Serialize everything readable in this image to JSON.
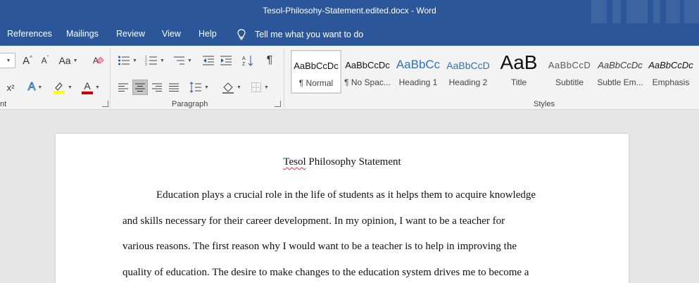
{
  "window": {
    "title": "Tesol-Philosohy-Statement.edited.docx  -  Word"
  },
  "menu": {
    "references": "References",
    "mailings": "Mailings",
    "review": "Review",
    "view": "View",
    "help": "Help",
    "tell_me": "Tell me what you want to do"
  },
  "ribbon": {
    "font_group_label_fragment": "nt",
    "paragraph_label": "Paragraph",
    "styles_label": "Styles",
    "case_label": "Aa",
    "grow_label": "A",
    "shrink_label": "A",
    "superscript_label": "x²",
    "text_effects_label": "A",
    "font_color_label": "A",
    "highlight_color": "#ffff00",
    "font_color": "#d00000"
  },
  "styles": [
    {
      "sample": "AaBbCcDc",
      "name": "¶ Normal"
    },
    {
      "sample": "AaBbCcDc",
      "name": "¶ No Spac..."
    },
    {
      "sample": "AaBbCc",
      "name": "Heading 1"
    },
    {
      "sample": "AaBbCcD",
      "name": "Heading 2"
    },
    {
      "sample": "AaB",
      "name": "Title"
    },
    {
      "sample": "AaBbCcD",
      "name": "Subtitle"
    },
    {
      "sample": "AaBbCcDc",
      "name": "Subtle Em..."
    },
    {
      "sample": "AaBbCcDc",
      "name": "Emphasis"
    }
  ],
  "document": {
    "title_word1": "Tesol",
    "title_rest": " Philosophy Statement",
    "lines": [
      "Education plays a crucial role in the life of students as it helps them to acquire knowledge",
      "and skills necessary for their career development. In my opinion, I want to be a teacher for",
      "various reasons. The first reason why I would want to be a teacher is to help in improving the",
      "quality of education. The desire to make changes to the education system drives me to become a"
    ]
  },
  "colors": {
    "title_bar": "#2b579a",
    "ribbon_bg": "#f3f3f3",
    "heading_blue": "#2e74b5",
    "spell_error": "#d13438"
  }
}
